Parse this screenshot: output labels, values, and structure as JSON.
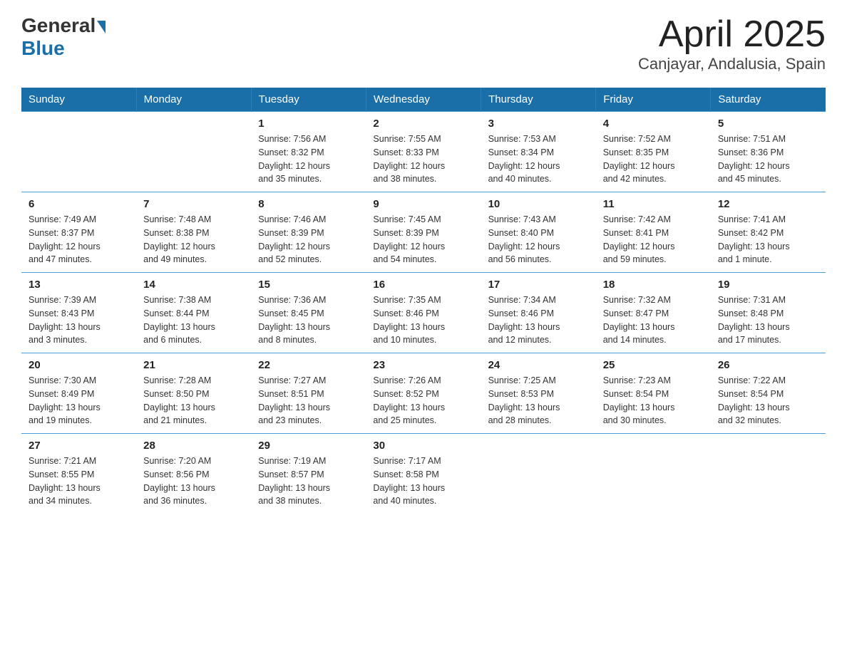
{
  "header": {
    "logo_general": "General",
    "logo_blue": "Blue",
    "title": "April 2025",
    "subtitle": "Canjayar, Andalusia, Spain"
  },
  "calendar": {
    "days_of_week": [
      "Sunday",
      "Monday",
      "Tuesday",
      "Wednesday",
      "Thursday",
      "Friday",
      "Saturday"
    ],
    "weeks": [
      [
        {
          "day": "",
          "info": ""
        },
        {
          "day": "",
          "info": ""
        },
        {
          "day": "1",
          "info": "Sunrise: 7:56 AM\nSunset: 8:32 PM\nDaylight: 12 hours\nand 35 minutes."
        },
        {
          "day": "2",
          "info": "Sunrise: 7:55 AM\nSunset: 8:33 PM\nDaylight: 12 hours\nand 38 minutes."
        },
        {
          "day": "3",
          "info": "Sunrise: 7:53 AM\nSunset: 8:34 PM\nDaylight: 12 hours\nand 40 minutes."
        },
        {
          "day": "4",
          "info": "Sunrise: 7:52 AM\nSunset: 8:35 PM\nDaylight: 12 hours\nand 42 minutes."
        },
        {
          "day": "5",
          "info": "Sunrise: 7:51 AM\nSunset: 8:36 PM\nDaylight: 12 hours\nand 45 minutes."
        }
      ],
      [
        {
          "day": "6",
          "info": "Sunrise: 7:49 AM\nSunset: 8:37 PM\nDaylight: 12 hours\nand 47 minutes."
        },
        {
          "day": "7",
          "info": "Sunrise: 7:48 AM\nSunset: 8:38 PM\nDaylight: 12 hours\nand 49 minutes."
        },
        {
          "day": "8",
          "info": "Sunrise: 7:46 AM\nSunset: 8:39 PM\nDaylight: 12 hours\nand 52 minutes."
        },
        {
          "day": "9",
          "info": "Sunrise: 7:45 AM\nSunset: 8:39 PM\nDaylight: 12 hours\nand 54 minutes."
        },
        {
          "day": "10",
          "info": "Sunrise: 7:43 AM\nSunset: 8:40 PM\nDaylight: 12 hours\nand 56 minutes."
        },
        {
          "day": "11",
          "info": "Sunrise: 7:42 AM\nSunset: 8:41 PM\nDaylight: 12 hours\nand 59 minutes."
        },
        {
          "day": "12",
          "info": "Sunrise: 7:41 AM\nSunset: 8:42 PM\nDaylight: 13 hours\nand 1 minute."
        }
      ],
      [
        {
          "day": "13",
          "info": "Sunrise: 7:39 AM\nSunset: 8:43 PM\nDaylight: 13 hours\nand 3 minutes."
        },
        {
          "day": "14",
          "info": "Sunrise: 7:38 AM\nSunset: 8:44 PM\nDaylight: 13 hours\nand 6 minutes."
        },
        {
          "day": "15",
          "info": "Sunrise: 7:36 AM\nSunset: 8:45 PM\nDaylight: 13 hours\nand 8 minutes."
        },
        {
          "day": "16",
          "info": "Sunrise: 7:35 AM\nSunset: 8:46 PM\nDaylight: 13 hours\nand 10 minutes."
        },
        {
          "day": "17",
          "info": "Sunrise: 7:34 AM\nSunset: 8:46 PM\nDaylight: 13 hours\nand 12 minutes."
        },
        {
          "day": "18",
          "info": "Sunrise: 7:32 AM\nSunset: 8:47 PM\nDaylight: 13 hours\nand 14 minutes."
        },
        {
          "day": "19",
          "info": "Sunrise: 7:31 AM\nSunset: 8:48 PM\nDaylight: 13 hours\nand 17 minutes."
        }
      ],
      [
        {
          "day": "20",
          "info": "Sunrise: 7:30 AM\nSunset: 8:49 PM\nDaylight: 13 hours\nand 19 minutes."
        },
        {
          "day": "21",
          "info": "Sunrise: 7:28 AM\nSunset: 8:50 PM\nDaylight: 13 hours\nand 21 minutes."
        },
        {
          "day": "22",
          "info": "Sunrise: 7:27 AM\nSunset: 8:51 PM\nDaylight: 13 hours\nand 23 minutes."
        },
        {
          "day": "23",
          "info": "Sunrise: 7:26 AM\nSunset: 8:52 PM\nDaylight: 13 hours\nand 25 minutes."
        },
        {
          "day": "24",
          "info": "Sunrise: 7:25 AM\nSunset: 8:53 PM\nDaylight: 13 hours\nand 28 minutes."
        },
        {
          "day": "25",
          "info": "Sunrise: 7:23 AM\nSunset: 8:54 PM\nDaylight: 13 hours\nand 30 minutes."
        },
        {
          "day": "26",
          "info": "Sunrise: 7:22 AM\nSunset: 8:54 PM\nDaylight: 13 hours\nand 32 minutes."
        }
      ],
      [
        {
          "day": "27",
          "info": "Sunrise: 7:21 AM\nSunset: 8:55 PM\nDaylight: 13 hours\nand 34 minutes."
        },
        {
          "day": "28",
          "info": "Sunrise: 7:20 AM\nSunset: 8:56 PM\nDaylight: 13 hours\nand 36 minutes."
        },
        {
          "day": "29",
          "info": "Sunrise: 7:19 AM\nSunset: 8:57 PM\nDaylight: 13 hours\nand 38 minutes."
        },
        {
          "day": "30",
          "info": "Sunrise: 7:17 AM\nSunset: 8:58 PM\nDaylight: 13 hours\nand 40 minutes."
        },
        {
          "day": "",
          "info": ""
        },
        {
          "day": "",
          "info": ""
        },
        {
          "day": "",
          "info": ""
        }
      ]
    ]
  }
}
